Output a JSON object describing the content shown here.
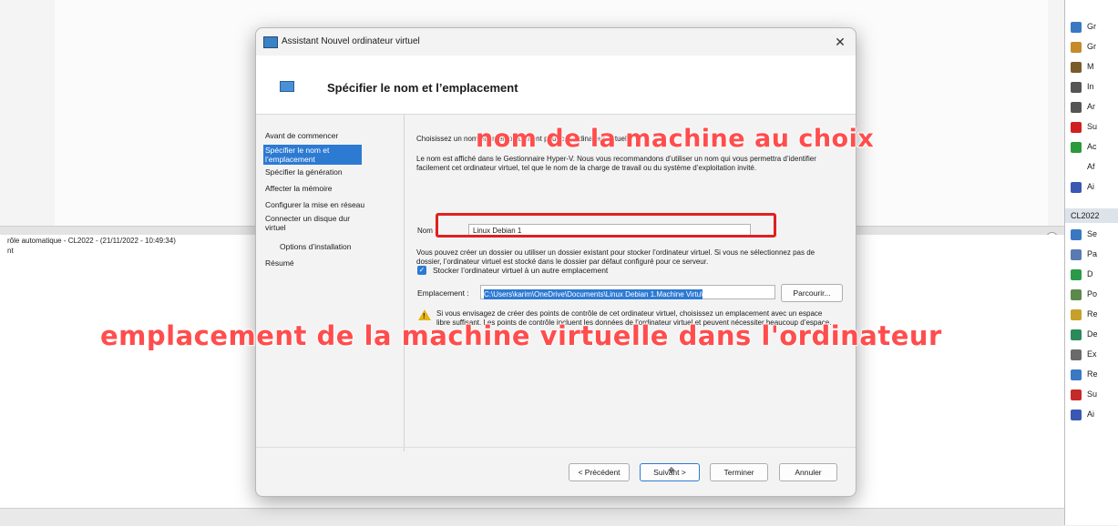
{
  "background": {
    "log_line_1": "rôle automatique - CL2022 - (21/11/2022 - 10:49:34)",
    "log_line_2": "nt",
    "collapse_symbol": "⊙"
  },
  "right_pane": {
    "actions": [
      {
        "label": "Gr",
        "icon": "grid-icon",
        "color": "#3a78c2"
      },
      {
        "label": "Gr",
        "icon": "users-icon",
        "color": "#c58a2a"
      },
      {
        "label": "M",
        "icon": "manage-icon",
        "color": "#7a5b2a"
      },
      {
        "label": "In",
        "icon": "import-icon",
        "color": "#555555"
      },
      {
        "label": "Ar",
        "icon": "stop-icon",
        "color": "#555555"
      },
      {
        "label": "Su",
        "icon": "delete-icon",
        "color": "#d12020"
      },
      {
        "label": "Ac",
        "icon": "refresh-icon",
        "color": "#2a9a3a"
      },
      {
        "label": "Af",
        "icon": "",
        "color": ""
      },
      {
        "label": "Ai",
        "icon": "help-icon",
        "color": "#3a58b2"
      }
    ],
    "section_header": "CL2022",
    "actions2": [
      {
        "label": "Se",
        "icon": "connect-icon",
        "color": "#3a78c2"
      },
      {
        "label": "Pa",
        "icon": "settings-icon",
        "color": "#5a7ab2"
      },
      {
        "label": "D",
        "icon": "start-icon",
        "color": "#2a9a4a"
      },
      {
        "label": "Po",
        "icon": "checkpoint-icon",
        "color": "#5a8a4a"
      },
      {
        "label": "Re",
        "icon": "revert-icon",
        "color": "#c5a02a"
      },
      {
        "label": "De",
        "icon": "move-icon",
        "color": "#2a8a5a"
      },
      {
        "label": "Ex",
        "icon": "export-icon",
        "color": "#6a6a6a"
      },
      {
        "label": "Re",
        "icon": "rename-icon",
        "color": "#3a78c2"
      },
      {
        "label": "Su",
        "icon": "delete-vm-icon",
        "color": "#c52a2a"
      },
      {
        "label": "Ai",
        "icon": "help-icon",
        "color": "#3a58b2"
      }
    ]
  },
  "dialog": {
    "title": "Assistant Nouvel ordinateur virtuel",
    "close_symbol": "✕",
    "header_title": "Spécifier le nom et l’emplacement",
    "nav": [
      {
        "label": "Avant de commencer",
        "active": false
      },
      {
        "label": "Spécifier le nom et l’emplacement",
        "active": true
      },
      {
        "label": "Spécifier la génération",
        "active": false
      },
      {
        "label": "Affecter la mémoire",
        "active": false
      },
      {
        "label": "Configurer la mise en réseau",
        "active": false
      },
      {
        "label": "Connecter un disque dur virtuel",
        "active": false
      },
      {
        "label": "Options d’installation",
        "active": false
      },
      {
        "label": "Résumé",
        "active": false
      }
    ],
    "intro_text": "Choisissez un nom et un emplacement pour cet ordinateur virtuel.",
    "info_text": "Le nom est affiché dans le Gestionnaire Hyper-V. Nous vous recommandons d’utiliser un nom qui vous permettra d’identifier facilement cet ordinateur virtuel, tel que le nom de la charge de travail ou du système d’exploitation invité.",
    "name_label": "Nom :",
    "name_value": "Linux Debian 1",
    "folder_text": "Vous pouvez créer un dossier ou utiliser un dossier existant pour stocker l’ordinateur virtuel. Si vous ne sélectionnez pas de dossier, l’ordinateur virtuel est stocké dans le dossier par défaut configuré pour ce serveur.",
    "checkbox_label": "Stocker l’ordinateur virtuel à un autre emplacement",
    "checkbox_mark": "✓",
    "location_label": "Emplacement :",
    "location_value": "C:\\Users\\karim\\OneDrive\\Documents\\Linux Debian 1.Machine Virtu\\",
    "browse_label": "Parcourir...",
    "warning_text": "Si vous envisagez de créer des points de contrôle de cet ordinateur virtuel, choisissez un emplacement avec un espace libre suffisant. Les points de contrôle incluent les données de l’ordinateur virtuel et peuvent nécessiter beaucoup d’espace.",
    "buttons": {
      "previous": "< Précédent",
      "next": "Suivant >",
      "finish": "Terminer",
      "cancel": "Annuler"
    }
  },
  "annotations": {
    "name_caption": "nom de la machine au choix",
    "location_caption": "emplacement de la machine virtuelle dans l'ordinateur",
    "caption_color": "#ff4d4d"
  }
}
